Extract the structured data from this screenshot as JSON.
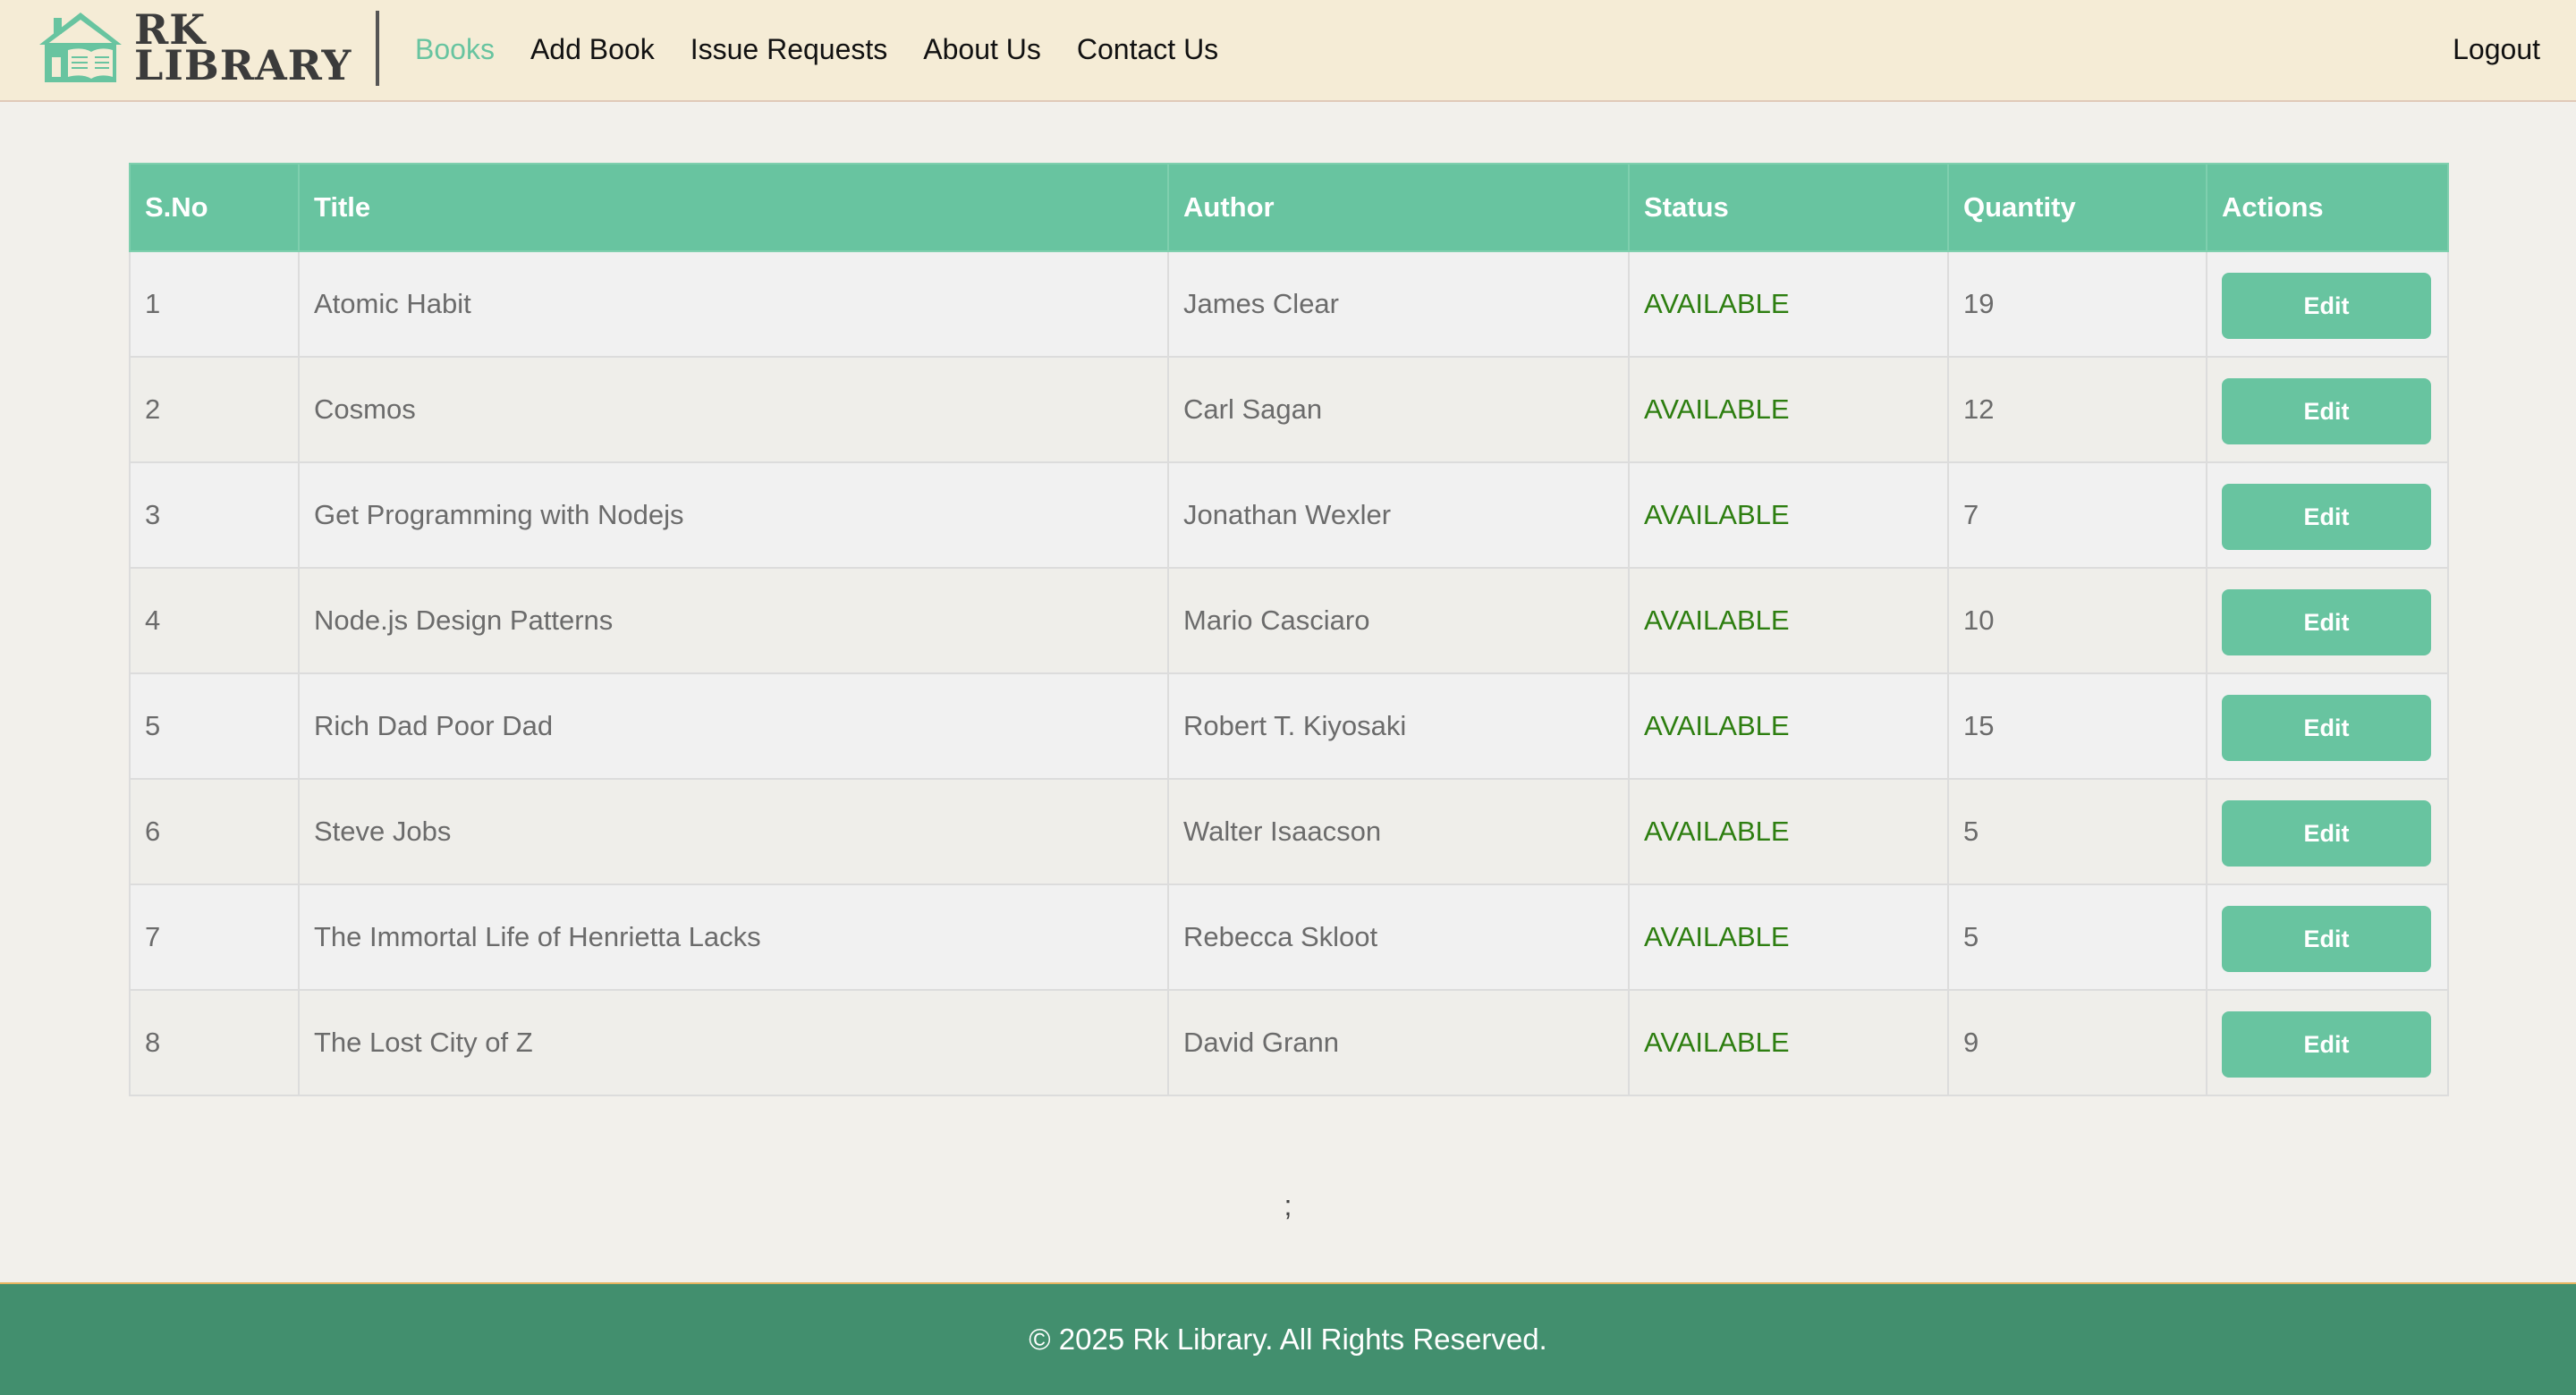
{
  "brand": {
    "line1": "RK",
    "line2": "LIBRARY",
    "colors": {
      "accent": "#68c4a0",
      "footer": "#428f6e",
      "status_available": "#2d7e10",
      "navbar_bg": "#f5ecd6"
    }
  },
  "nav": {
    "items": [
      {
        "label": "Books",
        "active": true
      },
      {
        "label": "Add Book",
        "active": false
      },
      {
        "label": "Issue Requests",
        "active": false
      },
      {
        "label": "About Us",
        "active": false
      },
      {
        "label": "Contact Us",
        "active": false
      }
    ],
    "logout": "Logout"
  },
  "table": {
    "headers": [
      "S.No",
      "Title",
      "Author",
      "Status",
      "Quantity",
      "Actions"
    ],
    "rows": [
      {
        "sno": "1",
        "title": "Atomic Habit",
        "author": "James Clear",
        "status": "AVAILABLE",
        "quantity": "19",
        "action": "Edit"
      },
      {
        "sno": "2",
        "title": "Cosmos",
        "author": "Carl Sagan",
        "status": "AVAILABLE",
        "quantity": "12",
        "action": "Edit"
      },
      {
        "sno": "3",
        "title": "Get Programming with Nodejs",
        "author": "Jonathan Wexler",
        "status": "AVAILABLE",
        "quantity": "7",
        "action": "Edit"
      },
      {
        "sno": "4",
        "title": "Node.js Design Patterns",
        "author": "Mario Casciaro",
        "status": "AVAILABLE",
        "quantity": "10",
        "action": "Edit"
      },
      {
        "sno": "5",
        "title": "Rich Dad Poor Dad",
        "author": "Robert T. Kiyosaki",
        "status": "AVAILABLE",
        "quantity": "15",
        "action": "Edit"
      },
      {
        "sno": "6",
        "title": "Steve Jobs",
        "author": "Walter Isaacson",
        "status": "AVAILABLE",
        "quantity": "5",
        "action": "Edit"
      },
      {
        "sno": "7",
        "title": "The Immortal Life of Henrietta Lacks",
        "author": "Rebecca Skloot",
        "status": "AVAILABLE",
        "quantity": "5",
        "action": "Edit"
      },
      {
        "sno": "8",
        "title": "The Lost City of Z",
        "author": "David Grann",
        "status": "AVAILABLE",
        "quantity": "9",
        "action": "Edit"
      }
    ]
  },
  "stray_text": ";",
  "footer": {
    "text": "© 2025 Rk Library. All Rights Reserved."
  }
}
